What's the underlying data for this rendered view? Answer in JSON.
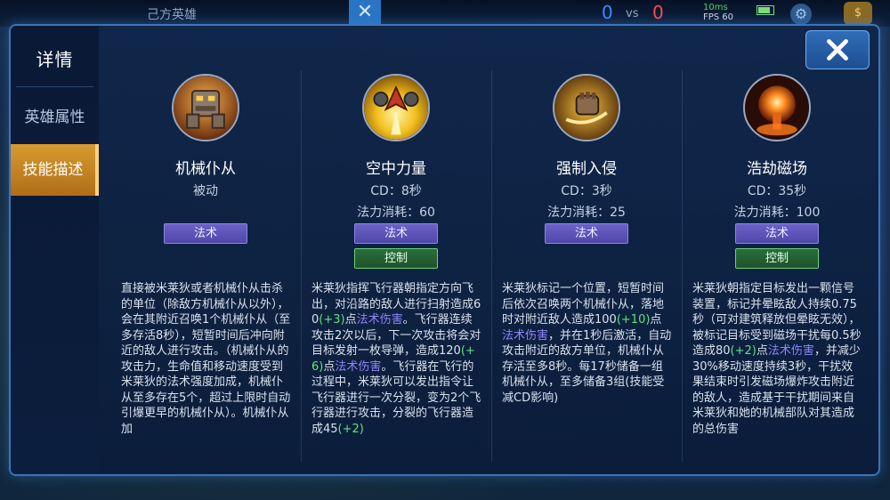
{
  "hud": {
    "team_title": "己方英雄",
    "score_blue": "0",
    "score_vs": "vs",
    "score_red": "0",
    "ping": "10ms",
    "fps": "FPS 60"
  },
  "sidebar": {
    "title": "详情",
    "tabs": [
      {
        "label": "英雄属性",
        "active": false
      },
      {
        "label": "技能描述",
        "active": true
      }
    ]
  },
  "close_icon": "close-icon",
  "colors": {
    "accent_gold": "#c8842a",
    "magic_tag": "#5a52b8",
    "control_tag": "#245f32",
    "number_highlight": "#63e083",
    "damage_type_highlight": "#8f86ff"
  },
  "skills": [
    {
      "icon": "mech-robot-icon",
      "name": "机械仆从",
      "sub1": "被动",
      "sub2": "",
      "tags": [
        "法术"
      ],
      "desc": [
        {
          "t": "直接被米莱狄或者机械仆从击杀的单位（除敌方机械仆从以外），会在其附近召唤1个机械仆从（至多存活8秒），短暂时间后冲向附近的敌人进行攻击。（机械仆从的攻击力，生命值和移动速度受到米莱狄的法术强度加成，机械仆从至多存在5个，超过上限时自动引爆更早的机械仆从）。机械仆从加"
        }
      ]
    },
    {
      "icon": "drone-fighter-icon",
      "name": "空中力量",
      "sub1": "CD：8秒",
      "sub2": "法力消耗：60",
      "tags": [
        "法术",
        "控制"
      ],
      "desc": [
        {
          "t": "米莱狄指挥飞行器朝指定方向飞出，对沿路的敌人进行扫射造成60"
        },
        {
          "t": "(+3)",
          "c": "num"
        },
        {
          "t": "点"
        },
        {
          "t": "法术伤害",
          "c": "tag"
        },
        {
          "t": "。飞行器连续攻击2次以后，下一次攻击将会对目标发射一枚导弹，造成120"
        },
        {
          "t": "(+6)",
          "c": "num"
        },
        {
          "t": "点"
        },
        {
          "t": "法术伤害",
          "c": "tag"
        },
        {
          "t": "。飞行器在飞行的过程中，米莱狄可以发出指令让飞行器进行一次分裂，变为2个飞行器进行攻击，分裂的飞行器造成45"
        },
        {
          "t": "(+2)",
          "c": "num"
        }
      ]
    },
    {
      "icon": "mech-fist-icon",
      "name": "强制入侵",
      "sub1": "CD：3秒",
      "sub2": "法力消耗：25",
      "tags": [
        "法术"
      ],
      "desc": [
        {
          "t": "米莱狄标记一个位置，短暂时间后依次召唤两个机械仆从，落地时对附近敌人造成100"
        },
        {
          "t": "(+10)",
          "c": "num"
        },
        {
          "t": "点"
        },
        {
          "t": "法术伤害",
          "c": "tag"
        },
        {
          "t": "，并在1秒后激活，自动攻击附近的敌方单位，机械仆从存活至多8秒。每17秒储备一组机械仆从，至多储备3组(技能受减CD影响)"
        }
      ]
    },
    {
      "icon": "explosion-icon",
      "name": "浩劫磁场",
      "sub1": "CD：35秒",
      "sub2": "法力消耗：100",
      "tags": [
        "法术",
        "控制"
      ],
      "desc": [
        {
          "t": "米莱狄朝指定目标发出一颗信号装置，标记并晕眩敌人持续0.75秒（可对建筑释放但晕眩无效），被标记目标受到磁场干扰每0.5秒造成80"
        },
        {
          "t": "(+2)",
          "c": "num"
        },
        {
          "t": "点"
        },
        {
          "t": "法术伤害",
          "c": "tag"
        },
        {
          "t": "，并减少30%移动速度持续3秒，干扰效果结束时引发磁场爆炸攻击附近的敌人，造成基于干扰期间来自米莱狄和她的机械部队对其造成的总伤害"
        }
      ]
    }
  ]
}
